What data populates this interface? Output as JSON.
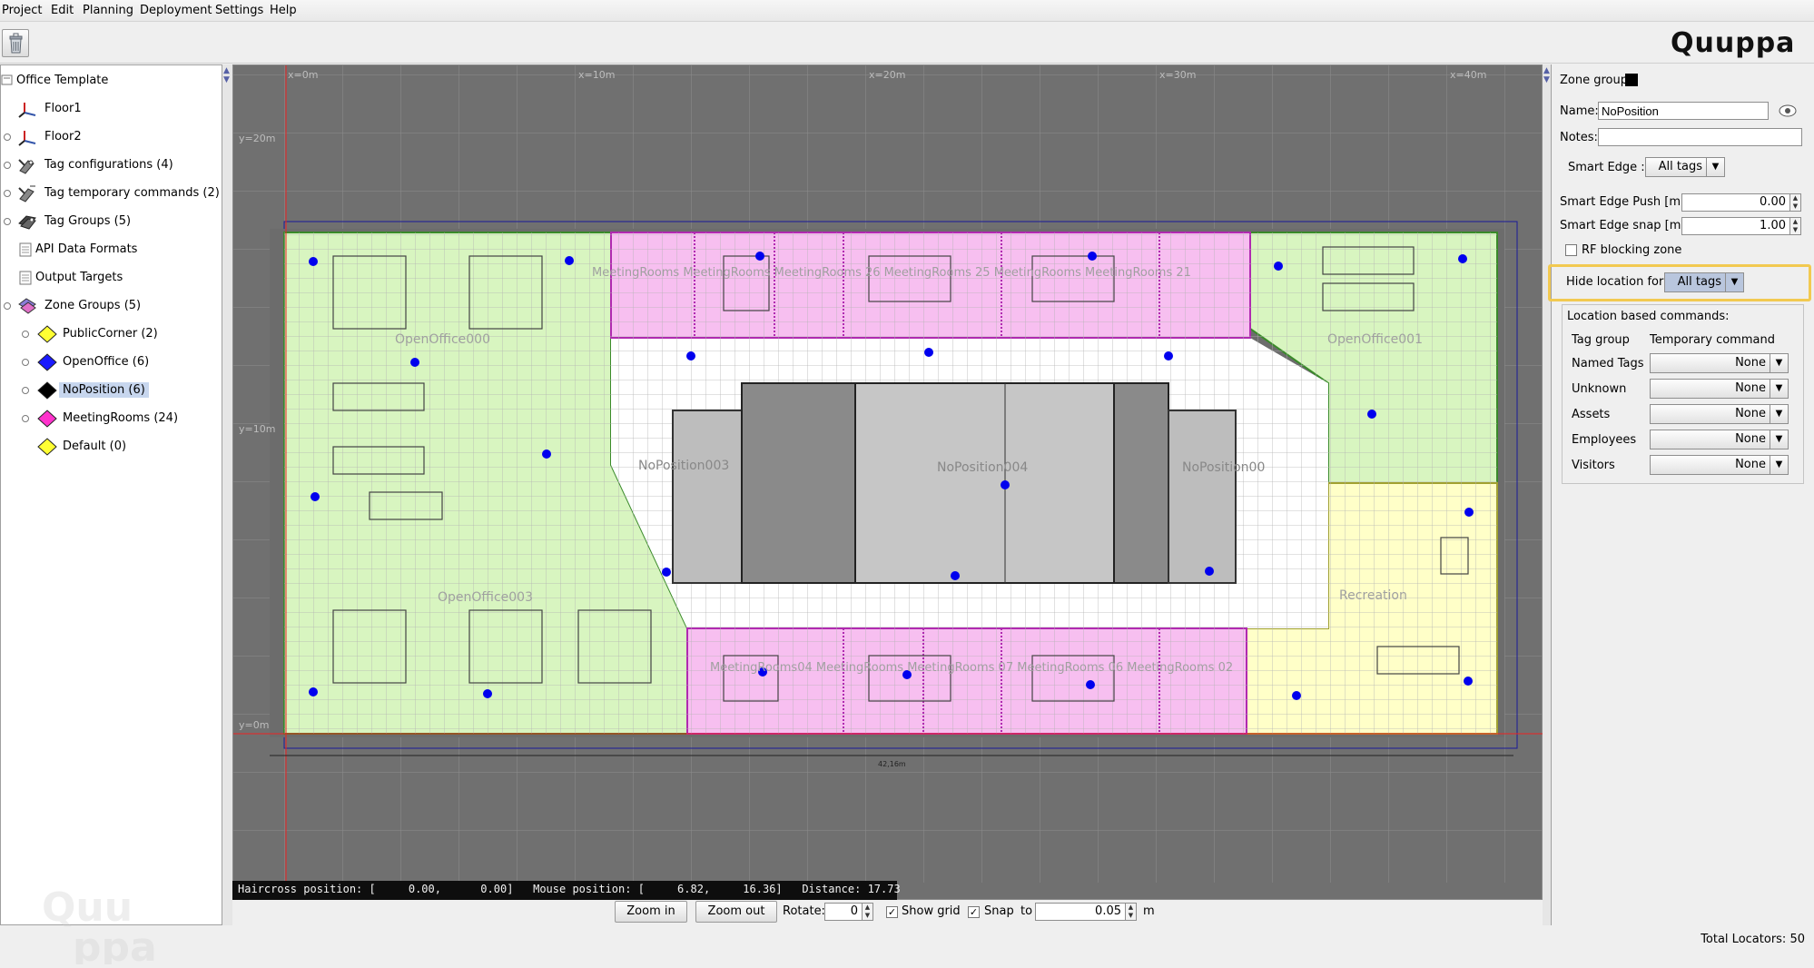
{
  "menu": {
    "items": [
      "Project",
      "Edit",
      "Planning",
      "Deployment",
      "Settings",
      "Help"
    ]
  },
  "toolbar": {
    "delete_icon": "trash-icon"
  },
  "brand": {
    "logo_text": "Quuppa"
  },
  "tree": {
    "root": "Office Template",
    "items": [
      {
        "label": "Floor1",
        "icon": "axes-icon"
      },
      {
        "label": "Floor2",
        "icon": "axes-icon"
      },
      {
        "label": "Tag configurations (4)",
        "icon": "tag-config-icon"
      },
      {
        "label": "Tag temporary commands (2)",
        "icon": "tag-command-icon"
      },
      {
        "label": "Tag Groups (5)",
        "icon": "tag-group-icon"
      },
      {
        "label": "API Data Formats",
        "icon": "api-format-icon"
      },
      {
        "label": "Output Targets",
        "icon": "output-target-icon"
      },
      {
        "label": "Zone Groups (5)",
        "icon": "zone-groups-icon"
      }
    ],
    "zone_groups": [
      {
        "label": "PublicCorner (2)",
        "color": "#ffff33"
      },
      {
        "label": "OpenOffice (6)",
        "color": "#1a1aff"
      },
      {
        "label": "NoPosition (6)",
        "color": "#000000",
        "selected": true
      },
      {
        "label": "MeetingRooms (24)",
        "color": "#ff33cc"
      },
      {
        "label": "Default (0)",
        "color": "#ffff33"
      }
    ]
  },
  "floorplan": {
    "axis_labels": {
      "x0": "x=0m",
      "x10": "x=10m",
      "x20": "x=20m",
      "x30": "x=30m",
      "x40": "x=40m",
      "y20": "y=20m",
      "y10": "y=10m",
      "y0": "y=0m"
    },
    "dimension_label": "42,16m",
    "zones": {
      "open_office_000": "OpenOffice000",
      "open_office_001": "OpenOffice001",
      "open_office_003": "OpenOffice003",
      "recreation": "Recreation",
      "no_position_003": "NoPosition003",
      "no_position_004": "NoPosition004",
      "no_position_00x": "NoPosition00",
      "meeting_top": "MeetingRooms MeetingRooms MeetingRooms 26 MeetingRooms 25 MeetingRooms MeetingRooms 21",
      "meeting_bottom": "MeetingRooms04 MeetingRooms MeetingRooms 07 MeetingRooms 06 MeetingRooms 02"
    },
    "colors": {
      "open_office": "#d8f5c0",
      "meeting": "#f7bff0",
      "recreation": "#ffffc8",
      "corridor": "#ffffff",
      "no_position": "#bdbdbd",
      "locator": "#0000ee"
    }
  },
  "status": {
    "text": "Haircross position: [     0.00,      0.00]   Mouse position: [     6.82,     16.36]   Distance: 17.73"
  },
  "bottom": {
    "zoom_in": "Zoom in",
    "zoom_out": "Zoom out",
    "rotate_label": "Rotate:",
    "rotate_value": "0",
    "show_grid_label": "Show grid",
    "show_grid_checked": true,
    "snap_label": "Snap",
    "snap_checked": true,
    "to_label": "to",
    "snap_value": "0.05",
    "unit": "m"
  },
  "props": {
    "header": "Zone group",
    "name_label": "Name:",
    "name_value": "NoPosition",
    "notes_label": "Notes:",
    "notes_value": "",
    "smart_edge_label": "Smart Edge :",
    "smart_edge_value": "All tags",
    "smart_edge_push_label": "Smart Edge Push  [m]:",
    "smart_edge_push_value": "0.00",
    "smart_edge_snap_label": "Smart Edge snap  [m]:",
    "smart_edge_snap_value": "1.00",
    "rf_blocking_label": "RF blocking zone",
    "rf_blocking_checked": false,
    "hide_location_label": "Hide location for:",
    "hide_location_value": "All tags",
    "lbc_title": "Location based commands:",
    "lbc_col1": "Tag group",
    "lbc_col2": "Temporary command",
    "lbc_rows": [
      {
        "group": "Named Tags",
        "command": "None"
      },
      {
        "group": "Unknown",
        "command": "None"
      },
      {
        "group": "Assets",
        "command": "None"
      },
      {
        "group": "Employees",
        "command": "None"
      },
      {
        "group": "Visitors",
        "command": "None"
      }
    ]
  },
  "footer": {
    "total_locators": "Total Locators: 50"
  }
}
